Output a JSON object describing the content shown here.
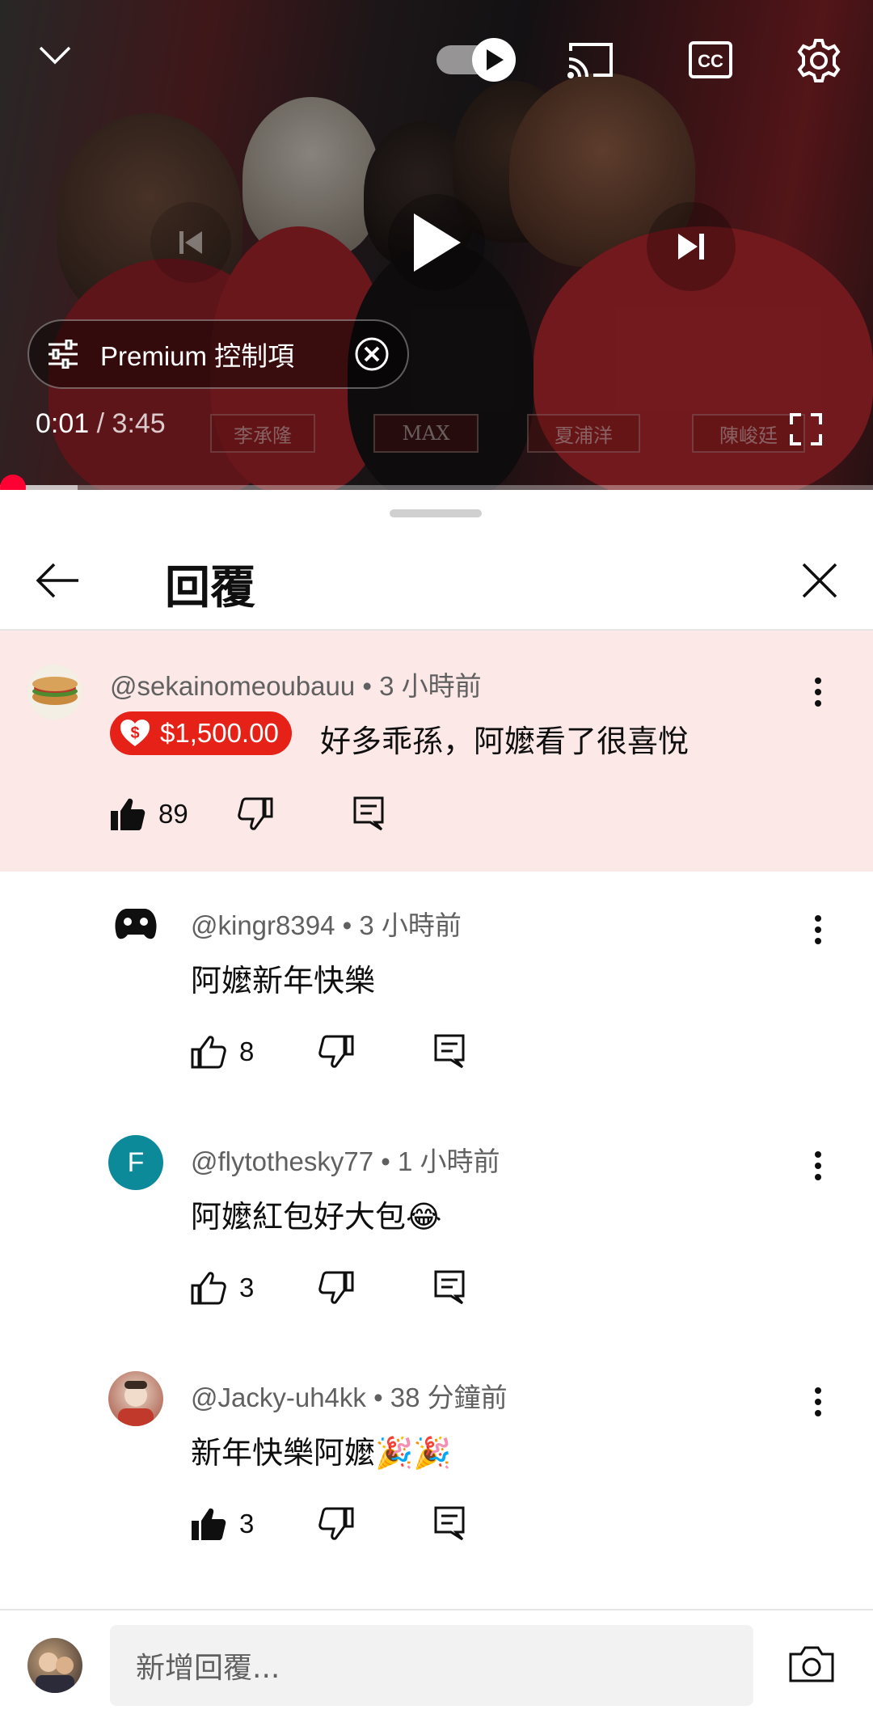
{
  "player": {
    "premium_chip_label": "Premium 控制項",
    "time_current": "0:01",
    "time_separator": " / ",
    "time_total": "3:45",
    "progress_fraction": 0.004,
    "name_plates": [
      "李承隆",
      "MAX",
      "夏浦洋",
      "陳峻廷"
    ],
    "icons": [
      "chevron-down-icon",
      "autoplay-toggle",
      "cast-icon",
      "captions-icon",
      "settings-gear-icon",
      "skip-previous-icon",
      "play-icon",
      "skip-next-icon",
      "sliders-icon",
      "close-circle-icon",
      "fullscreen-icon"
    ]
  },
  "panel": {
    "title": "回覆"
  },
  "comments": [
    {
      "author": "@sekainomeoubauu",
      "time": "3 小時前",
      "super_chat_amount": "$1,500.00",
      "text": "好多乖孫，阿嬤看了很喜悅",
      "likes": "89",
      "liked": true,
      "highlighted": true
    },
    {
      "author": "@kingr8394",
      "time": "3 小時前",
      "text": "阿嬤新年快樂",
      "likes": "8",
      "liked": false
    },
    {
      "author": "@flytothesky77",
      "avatar_letter": "F",
      "avatar_color": "#0c8a9a",
      "time": "1 小時前",
      "text": "阿嬤紅包好大包",
      "emoji": "😂",
      "likes": "3",
      "liked": false
    },
    {
      "author": "@Jacky-uh4kk",
      "time": "38 分鐘前",
      "text": "新年快樂阿嬤",
      "emoji": "🎉🎉",
      "likes": "3",
      "liked": true
    }
  ],
  "composer": {
    "placeholder": "新增回覆..."
  },
  "colors": {
    "accent_red": "#ff0033",
    "super_chat_red": "#e62117",
    "highlight_bg": "#fde8e8"
  }
}
